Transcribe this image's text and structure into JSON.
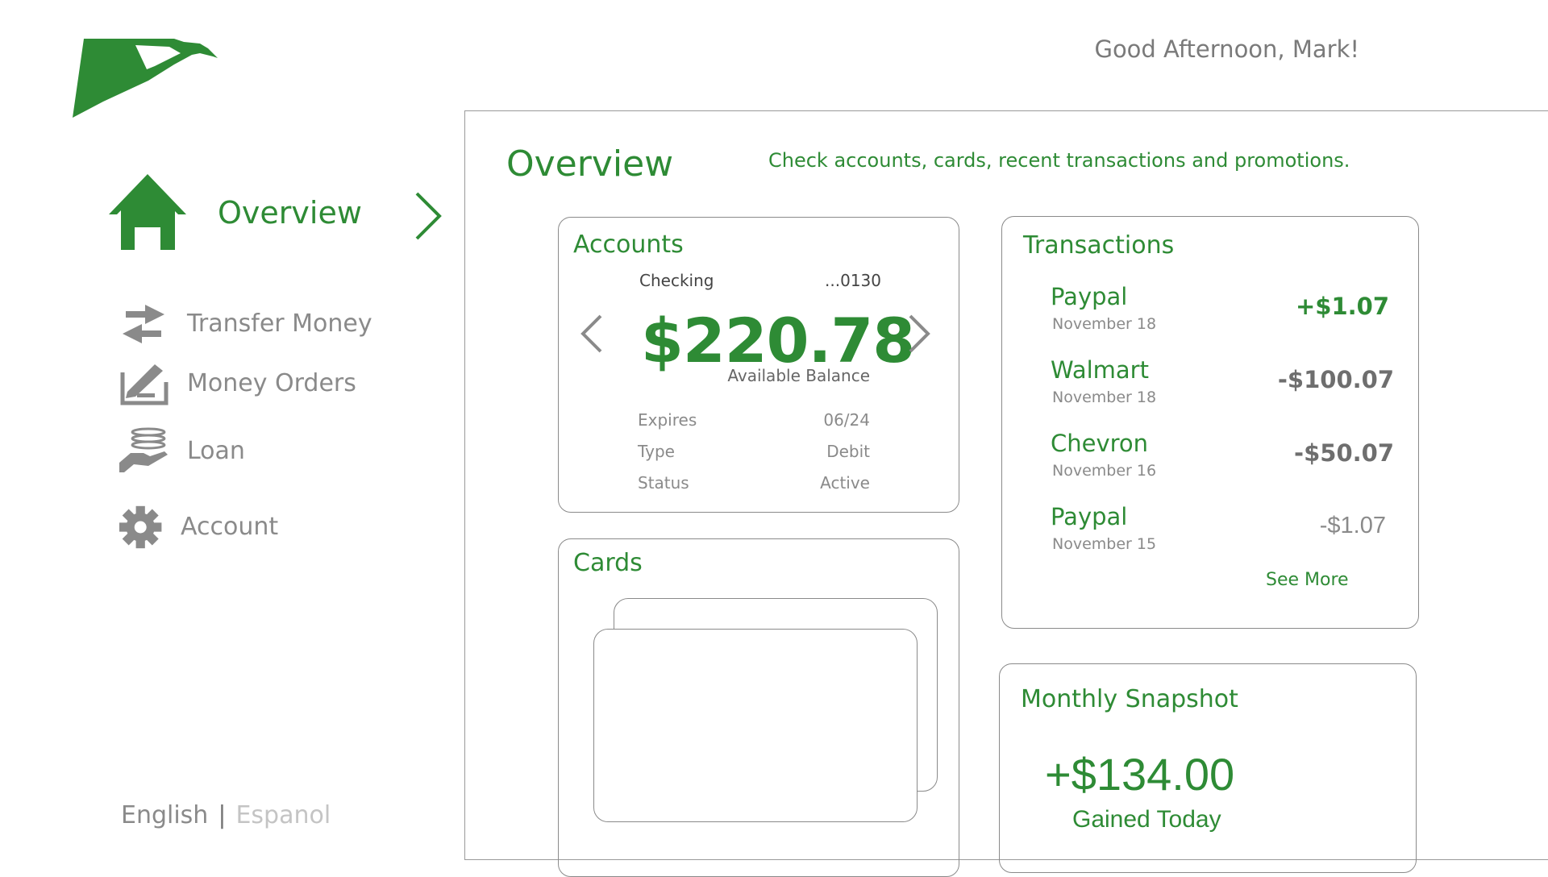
{
  "header": {
    "greeting": "Good Afternoon, Mark!",
    "logo_icon": "eagle-logo-icon"
  },
  "sidebar": {
    "active": {
      "label": "Overview",
      "icon": "home-icon"
    },
    "items": [
      {
        "label": "Transfer Money",
        "icon": "transfer-arrows-icon"
      },
      {
        "label": "Money Orders",
        "icon": "money-order-icon"
      },
      {
        "label": "Loan",
        "icon": "loan-hand-icon"
      },
      {
        "label": "Account",
        "icon": "gear-icon"
      }
    ],
    "languages": {
      "current": "English",
      "separator": "|",
      "other": "Espanol"
    }
  },
  "main": {
    "title": "Overview",
    "subtitle": "Check accounts, cards, recent transactions and promotions."
  },
  "accounts": {
    "title": "Accounts",
    "account_type": "Checking",
    "account_number": "...0130",
    "balance": "$220.78",
    "balance_label": "Available Balance",
    "details": [
      {
        "key": "Expires",
        "value": "06/24"
      },
      {
        "key": "Type",
        "value": "Debit"
      },
      {
        "key": "Status",
        "value": "Active"
      }
    ]
  },
  "cards": {
    "title": "Cards"
  },
  "transactions": {
    "title": "Transactions",
    "items": [
      {
        "merchant": "Paypal",
        "date": "November 18",
        "amount": "+$1.07"
      },
      {
        "merchant": "Walmart",
        "date": "November 18",
        "amount": "-$100.07"
      },
      {
        "merchant": "Chevron",
        "date": "November 16",
        "amount": "-$50.07"
      },
      {
        "merchant": "Paypal",
        "date": "November 15",
        "amount": "-$1.07"
      }
    ],
    "see_more": "See More"
  },
  "snapshot": {
    "title": "Monthly Snapshot",
    "amount": "+$134.00",
    "label": "Gained Today"
  },
  "colors": {
    "brand_green": "#2e8b35",
    "muted_grey": "#8a8a8a",
    "border": "#8a8a8a"
  }
}
